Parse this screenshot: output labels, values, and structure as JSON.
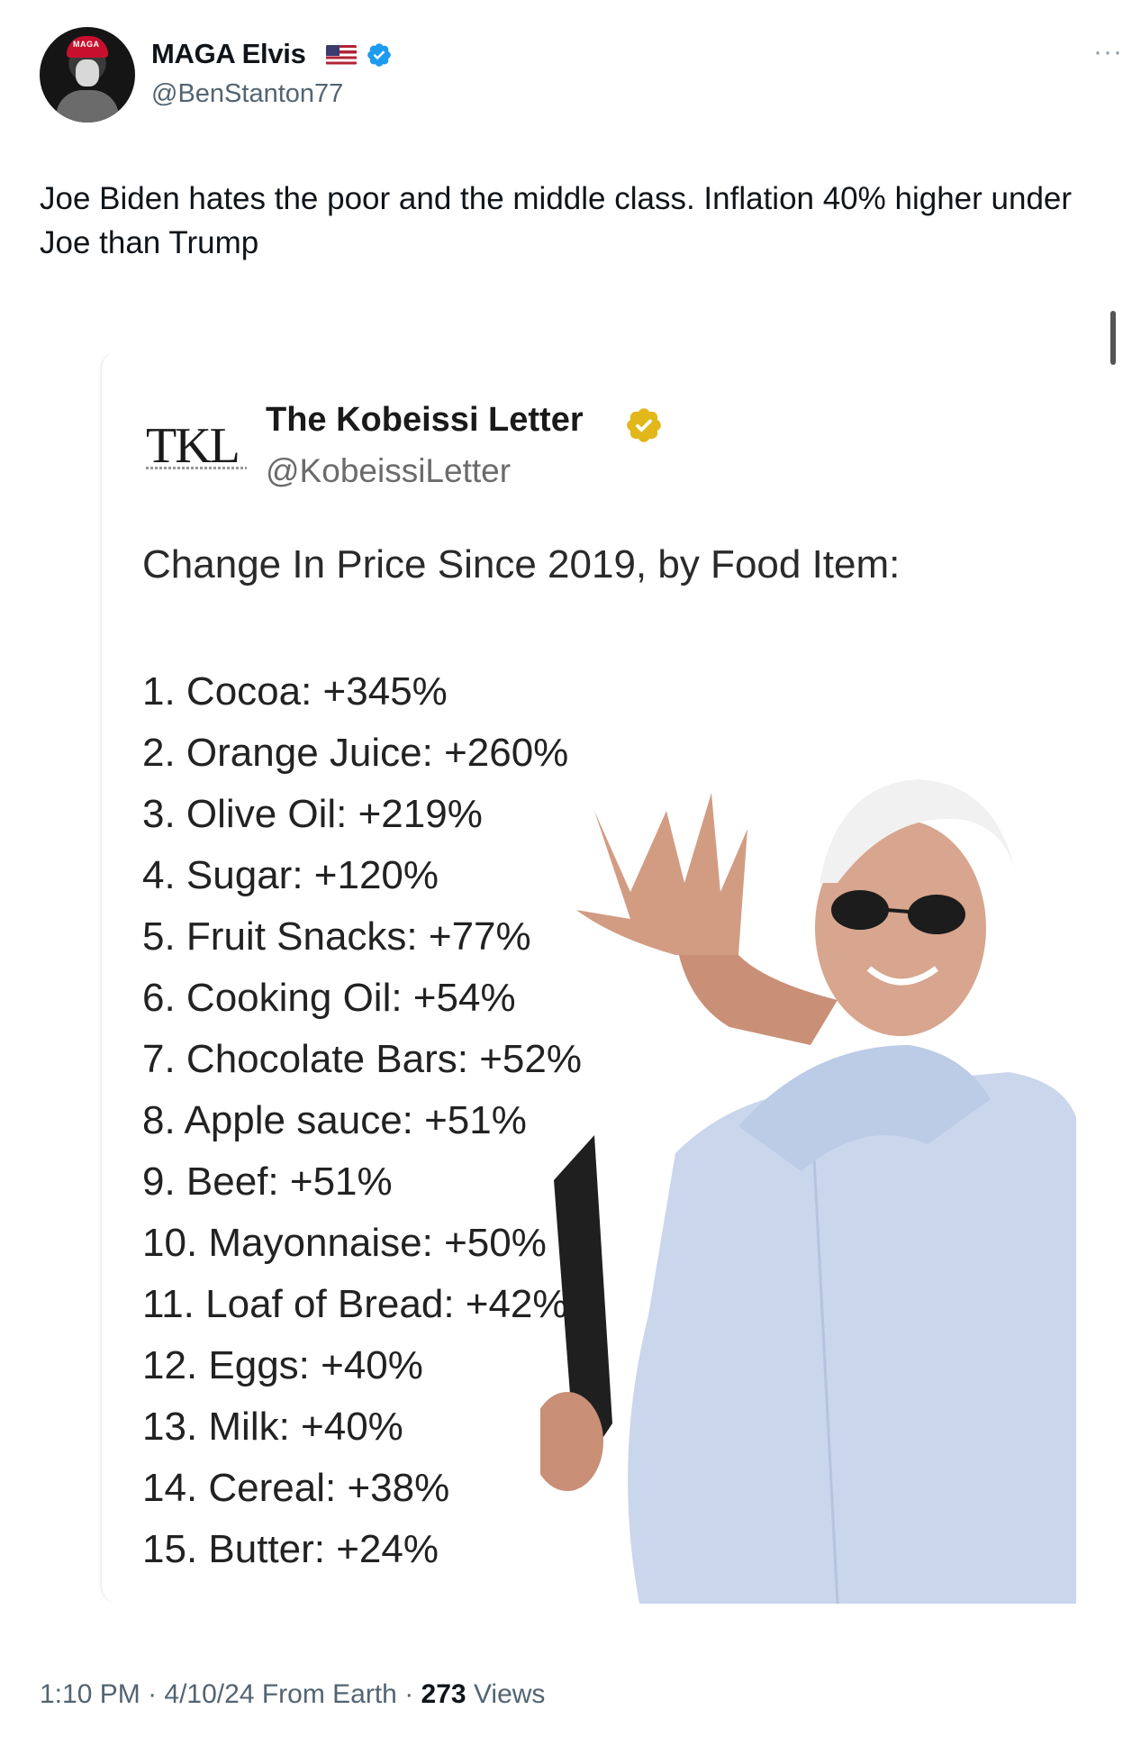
{
  "author": {
    "display_name": "MAGA Elvis",
    "handle": "@BenStanton77",
    "avatar_hat_text": "MAGA",
    "flag": "us-flag-icon",
    "verified_color": "#1d9bf0"
  },
  "tweet": {
    "text": "Joe Biden hates the poor and the middle class. Inflation 40% higher under Joe than Trump"
  },
  "quoted": {
    "logo_text": "TKL",
    "name": "The Kobeissi Letter",
    "handle": "@KobeissiLetter",
    "verified_color": "#e2b719",
    "heading": "Change In Price Since 2019, by Food Item:",
    "items": [
      "1. Cocoa: +345%",
      "2. Orange Juice: +260%",
      "3. Olive Oil: +219%",
      "4. Sugar: +120%",
      "5. Fruit Snacks: +77%",
      "6. Cooking Oil: +54%",
      "7. Chocolate Bars: +52%",
      "8. Apple sauce: +51%",
      "9. Beef: +51%",
      "10. Mayonnaise: +50%",
      "11. Loaf of Bread: +42%",
      "12. Eggs: +40%",
      "13. Milk: +40%",
      "14. Cereal: +38%",
      "15. Butter: +24%"
    ]
  },
  "meta": {
    "time": "1:10 PM",
    "sep1": " · ",
    "date": "4/10/24",
    "source": " From Earth",
    "sep2": " · ",
    "views_count": "273",
    "views_label": " Views"
  }
}
